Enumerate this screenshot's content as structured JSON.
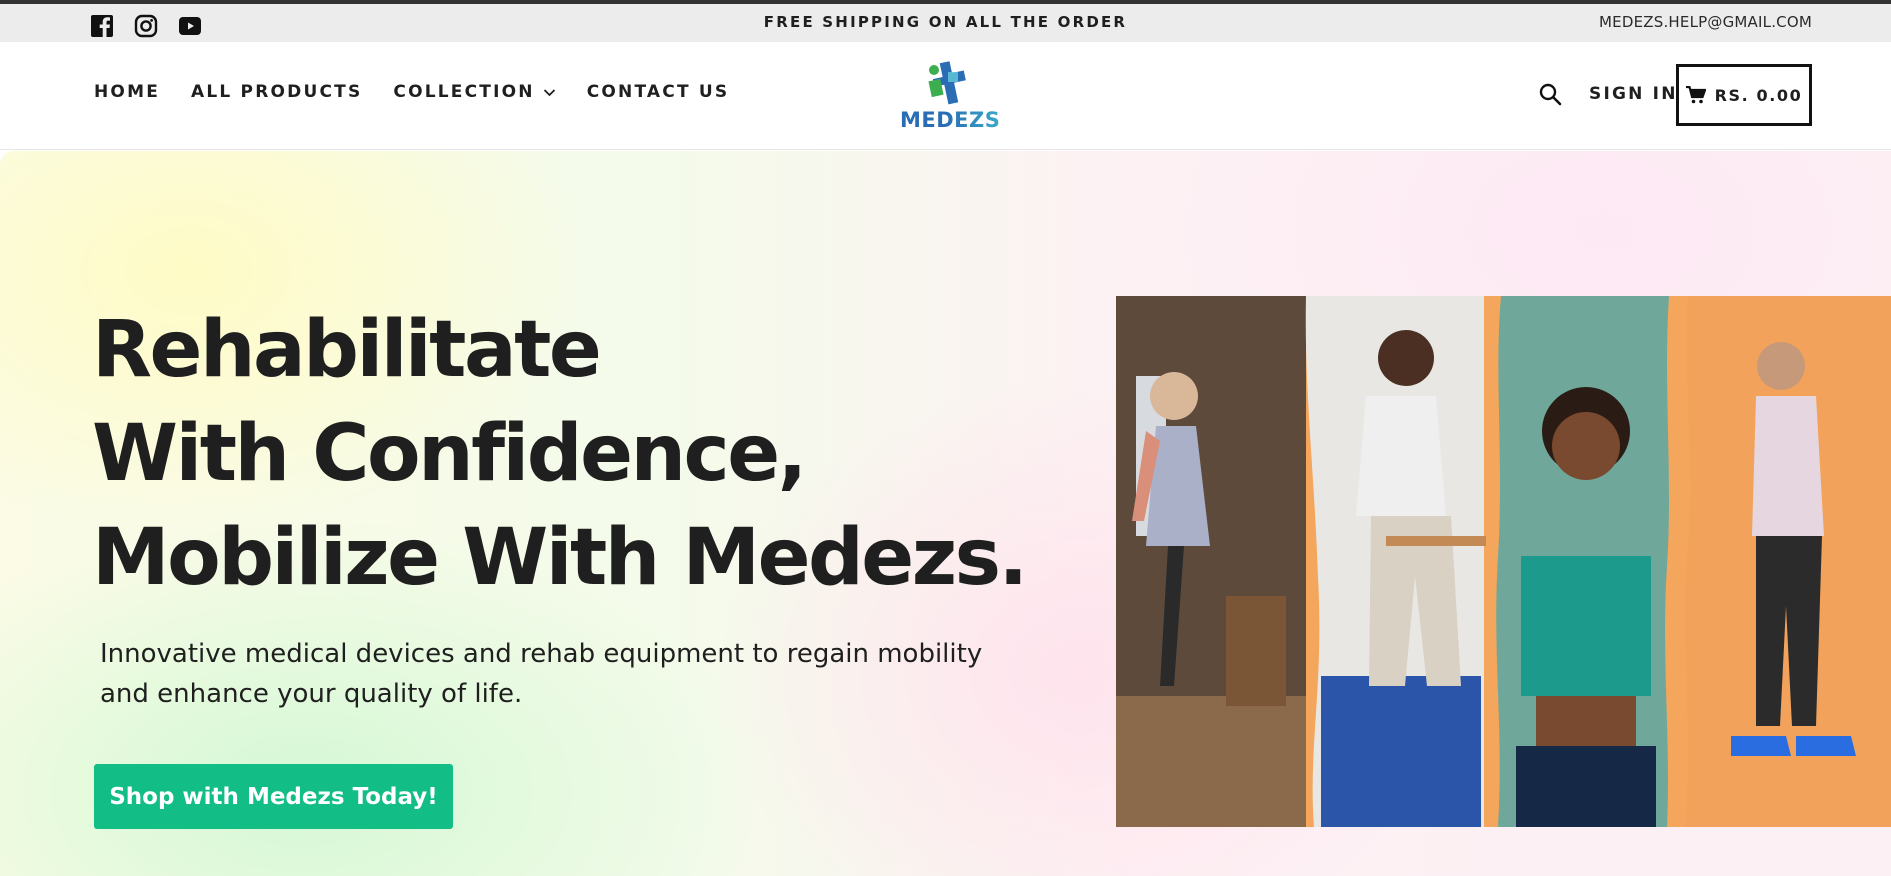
{
  "announcement": {
    "text": "FREE SHIPPING ON ALL THE ORDER",
    "email": "MEDEZS.HELP@GMAIL.COM",
    "social_icons": [
      "facebook-icon",
      "instagram-icon",
      "youtube-icon"
    ]
  },
  "nav": {
    "items": [
      {
        "label": "HOME"
      },
      {
        "label": "ALL PRODUCTS"
      },
      {
        "label": "COLLECTION"
      },
      {
        "label": "CONTACT US"
      }
    ],
    "logo_text": "MEDEZS",
    "sign_in": "SIGN IN",
    "cart_amount": "RS. 0.00"
  },
  "hero": {
    "headline_lines": [
      "Rehabilitate",
      "With Confidence,",
      "Mobilize With Medezs."
    ],
    "subtext": "Innovative medical devices and rehab equipment to regain mobility and enhance your quality of life.",
    "cta": "Shop with Medezs Today!"
  },
  "colors": {
    "brand_green": "#12bd86",
    "logo_blue": "#2a6db5",
    "logo_green": "#3cae4f",
    "accent_orange": "#f3a65c"
  }
}
